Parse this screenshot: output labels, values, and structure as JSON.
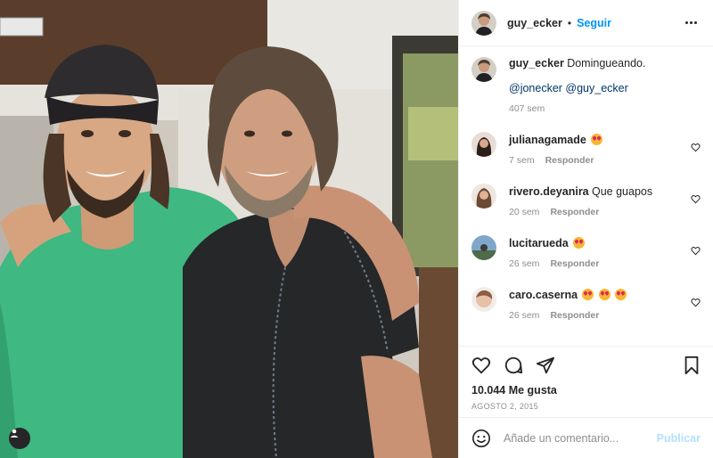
{
  "post": {
    "author": "guy_ecker",
    "dot": "•",
    "follow_label": "Seguir",
    "caption_text": "Domingueando.",
    "caption_mentions": "@jonecker @guy_ecker",
    "caption_time": "407 sem"
  },
  "comments": [
    {
      "user": "julianagamade",
      "text": "",
      "emoji_count": 1,
      "time": "7 sem",
      "reply": "Responder"
    },
    {
      "user": "rivero.deyanira",
      "text": "Que guapos",
      "emoji_count": 0,
      "time": "20 sem",
      "reply": "Responder"
    },
    {
      "user": "lucitarueda",
      "text": "",
      "emoji_count": 1,
      "time": "26 sem",
      "reply": "Responder"
    },
    {
      "user": "caro.caserna",
      "text": "",
      "emoji_count": 3,
      "time": "26 sem",
      "reply": "Responder"
    }
  ],
  "stats": {
    "likes": "10.044 Me gusta",
    "date": "AGOSTO 2, 2015"
  },
  "composer": {
    "placeholder": "Añade un comentario...",
    "publish_label": "Publicar"
  },
  "icons": {
    "like": "heart-icon",
    "comment": "comment-icon",
    "share": "paper-plane-icon",
    "save": "bookmark-icon",
    "emoji": "smiley-icon",
    "more": "more-options-icon",
    "tag": "user-tag-icon"
  },
  "colors": {
    "accent": "#0095f6",
    "link": "#00376b",
    "muted": "#8e8e8e",
    "publish_disabled": "#b2dffc"
  }
}
